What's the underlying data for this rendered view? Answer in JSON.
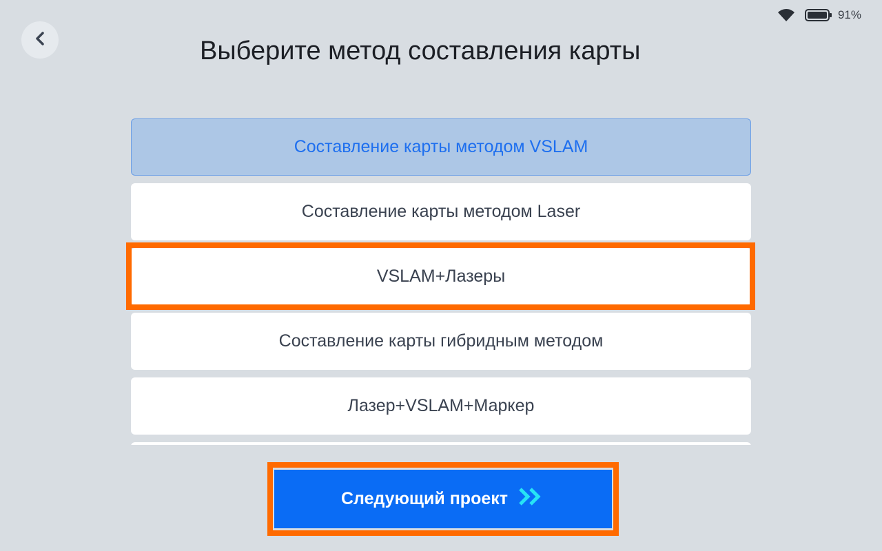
{
  "status_bar": {
    "battery_percent": "91%",
    "icons": [
      "wifi-icon",
      "battery-icon"
    ]
  },
  "header": {
    "back_icon": "chevron-left-icon",
    "title": "Выберите метод составления карты"
  },
  "options": [
    {
      "label": "Составление карты методом VSLAM",
      "selected": true
    },
    {
      "label": "Составление карты методом Laser",
      "selected": false
    },
    {
      "label": "VSLAM+Лазеры",
      "selected": false
    },
    {
      "label": "Составление карты гибридным методом",
      "selected": false
    },
    {
      "label": "Лазер+VSLAM+Маркер",
      "selected": false
    }
  ],
  "footer": {
    "next_label": "Следующий проект",
    "next_icon": "double-chevron-right-icon"
  },
  "colors": {
    "background": "#d8dde2",
    "selected_bg": "#adc7e6",
    "selected_text": "#1e6fef",
    "primary_button": "#0a6cf5",
    "highlight": "#ff6a00",
    "arrow_accent": "#27e3f5"
  }
}
